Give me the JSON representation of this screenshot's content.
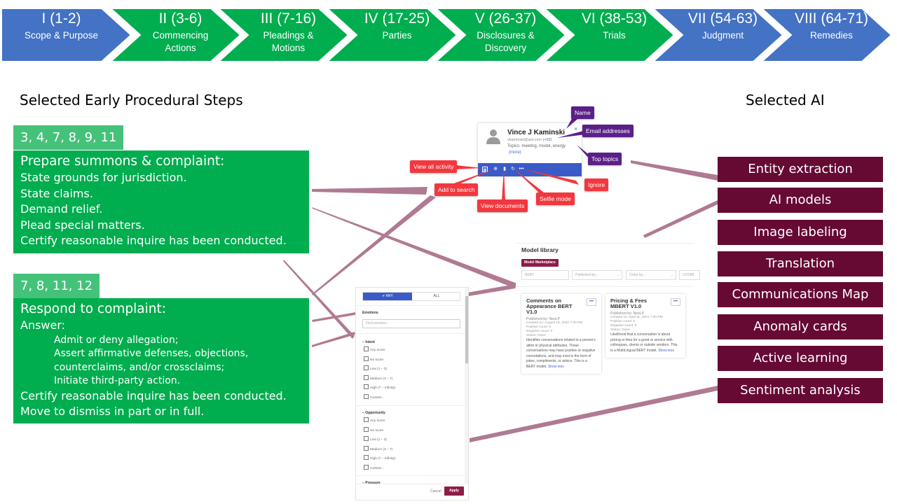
{
  "phases": [
    {
      "numeral": "I (1-2)",
      "label_lines": [
        "Scope & Purpose"
      ],
      "color": "#4472c4"
    },
    {
      "numeral": "II (3-6)",
      "label_lines": [
        "Commencing",
        "Actions"
      ],
      "color": "#00ad4f"
    },
    {
      "numeral": "III (7-16)",
      "label_lines": [
        "Pleadings &",
        "Motions"
      ],
      "color": "#00ad4f"
    },
    {
      "numeral": "IV (17-25)",
      "label_lines": [
        "Parties"
      ],
      "color": "#00ad4f"
    },
    {
      "numeral": "V (26-37)",
      "label_lines": [
        "Disclosures &",
        "Discovery"
      ],
      "color": "#00ad4f"
    },
    {
      "numeral": "VI (38-53)",
      "label_lines": [
        "Trials"
      ],
      "color": "#00ad4f"
    },
    {
      "numeral": "VII (54-63)",
      "label_lines": [
        "Judgment"
      ],
      "color": "#4472c4"
    },
    {
      "numeral": "VIII (64-71)",
      "label_lines": [
        "Remedies"
      ],
      "color": "#4472c4"
    }
  ],
  "left_title": "Selected Early Procedural Steps",
  "right_title": "Selected AI",
  "step_groups": [
    {
      "rules": "3, 4, 7, 8, 9, 11",
      "lines": [
        {
          "text": "Prepare summons & complaint:",
          "style": "head"
        },
        {
          "text": "State grounds for jurisdiction.",
          "style": "normal"
        },
        {
          "text": "State claims.",
          "style": "normal"
        },
        {
          "text": "Demand relief.",
          "style": "normal"
        },
        {
          "text": "Plead special matters.",
          "style": "normal"
        },
        {
          "text": "Certify reasonable inquire has been conducted.",
          "style": "normal"
        }
      ]
    },
    {
      "rules": "7, 8, 11, 12",
      "lines": [
        {
          "text": "Respond to complaint:",
          "style": "head"
        },
        {
          "text": "Answer:",
          "style": "normal"
        },
        {
          "text": "Admit or deny allegation;",
          "style": "sub"
        },
        {
          "text": "Assert affirmative defenses, objections,",
          "style": "sub"
        },
        {
          "text": "counterclaims, and/or crossclaims;",
          "style": "sub"
        },
        {
          "text": "Initiate third-party action.",
          "style": "sub"
        },
        {
          "text": "Certify reasonable inquire has been conducted.",
          "style": "normal"
        },
        {
          "text": "Move to dismiss in part or in full.",
          "style": "normal"
        }
      ]
    }
  ],
  "ai_items": [
    "Entity extraction",
    "AI models",
    "Image labeling",
    "Translation",
    "Communications Map",
    "Anomaly cards",
    "Active learning",
    "Sentiment analysis"
  ],
  "contact_card": {
    "name": "Vince J Kaminski",
    "email": "vkaminski@aol.com",
    "email_count": "(+55)",
    "topics": "Topics: meeting, model, energy",
    "more": "(more)",
    "close": "×",
    "callouts": {
      "name": "Name",
      "email_addresses": "Email addresses",
      "top_topics": "Top topics",
      "view_all_activity": "View all activity",
      "add_to_search": "Add to search",
      "view_documents": "View documents",
      "selfie_mode": "Selfie mode",
      "ignore": "Ignore"
    }
  },
  "model_library": {
    "title": "Model library",
    "marketplace_button": "Model Marketplace",
    "search_value": "BERT",
    "published_by_placeholder": "Published by...",
    "order_by_placeholder": "Order by...",
    "extra_filter": "COSMI",
    "cards": [
      {
        "title": "Comments on Appearance BERT V1.0",
        "published_by": "Published by:  NexLP",
        "created_on": "Created on:  August 18, 2020 7:00 PM",
        "positive_count": "Positive count:  0",
        "negative_count": "Negative count:  0",
        "status": "Status:  Done",
        "description": "Identifies conversations related to a person's attire or physical attributes. These conversations may have positive or negative connotations, and may exist in the form of jokes, compliments, or advice. This is a BERT model.",
        "show_less": "Show less"
      },
      {
        "title": "Pricing & Fees MBERT V1.0",
        "published_by": "Published by:  NexLP",
        "created_on": "Created on:  April 11, 2021 7:00 PM",
        "positive_count": "Positive count:  0",
        "negative_count": "Negative count:  0",
        "status": "Status:  Done",
        "description": "Likelihood that a conversation is about pricing or fees for a good or service with colleagues, clients or outside vendors. This is a MultiLingual BERT model.",
        "show_less": "Show less"
      }
    ]
  },
  "filter_panel": {
    "any_label": "✔ ANY",
    "all_label": "ALL",
    "emotions_label": "Emotions",
    "find_placeholder": "Find emotion...",
    "sections": [
      {
        "label": "− Intent",
        "options": [
          "Any score",
          "No score",
          "Low (1 – 3)",
          "Medium (3 – 7)",
          "High (7 – Infinity)",
          "Custom..."
        ]
      },
      {
        "label": "− Opportunity",
        "options": [
          "Any score",
          "No score",
          "Low (1 – 3)",
          "Medium (3 – 7)",
          "High (7 – Infinity)",
          "Custom..."
        ]
      },
      {
        "label": "− Pressure",
        "options": []
      }
    ],
    "cancel_label": "Cancel",
    "apply_label": "Apply"
  },
  "colors": {
    "phase_blue": "#4472c4",
    "phase_green": "#00ad4f",
    "tag_green": "#45c27a",
    "ai_maroon": "#660a33",
    "connector": "#b07a92",
    "callout_red": "#f2383e",
    "callout_purple": "#5b2088"
  }
}
